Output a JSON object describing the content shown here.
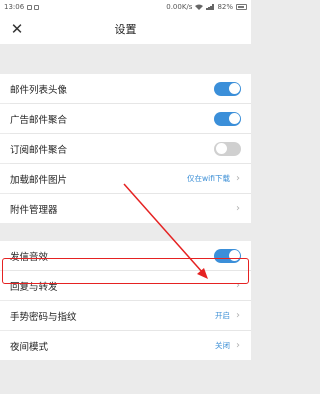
{
  "status_bar": {
    "time": "13:06",
    "speed": "0.00K/s",
    "battery": "82%"
  },
  "header": {
    "title": "设置",
    "close_icon": "close-icon"
  },
  "settings": [
    {
      "label": "邮件列表头像",
      "control": "toggle",
      "on": true
    },
    {
      "label": "广告邮件聚合",
      "control": "toggle",
      "on": true
    },
    {
      "label": "订阅邮件聚合",
      "control": "toggle",
      "on": false
    },
    {
      "label": "加载邮件图片",
      "control": "value",
      "value": "仅在wifi下载"
    },
    {
      "label": "附件管理器",
      "control": "chevron"
    },
    {
      "label": "发信音效",
      "control": "toggle",
      "on": true
    },
    {
      "label": "回复与转发",
      "control": "chevron"
    },
    {
      "label": "手势密码与指纹",
      "control": "value",
      "value": "开启"
    },
    {
      "label": "夜间模式",
      "control": "value",
      "value": "关闭"
    }
  ],
  "colors": {
    "accent": "#3b8fd9",
    "annotation": "#e52222"
  }
}
